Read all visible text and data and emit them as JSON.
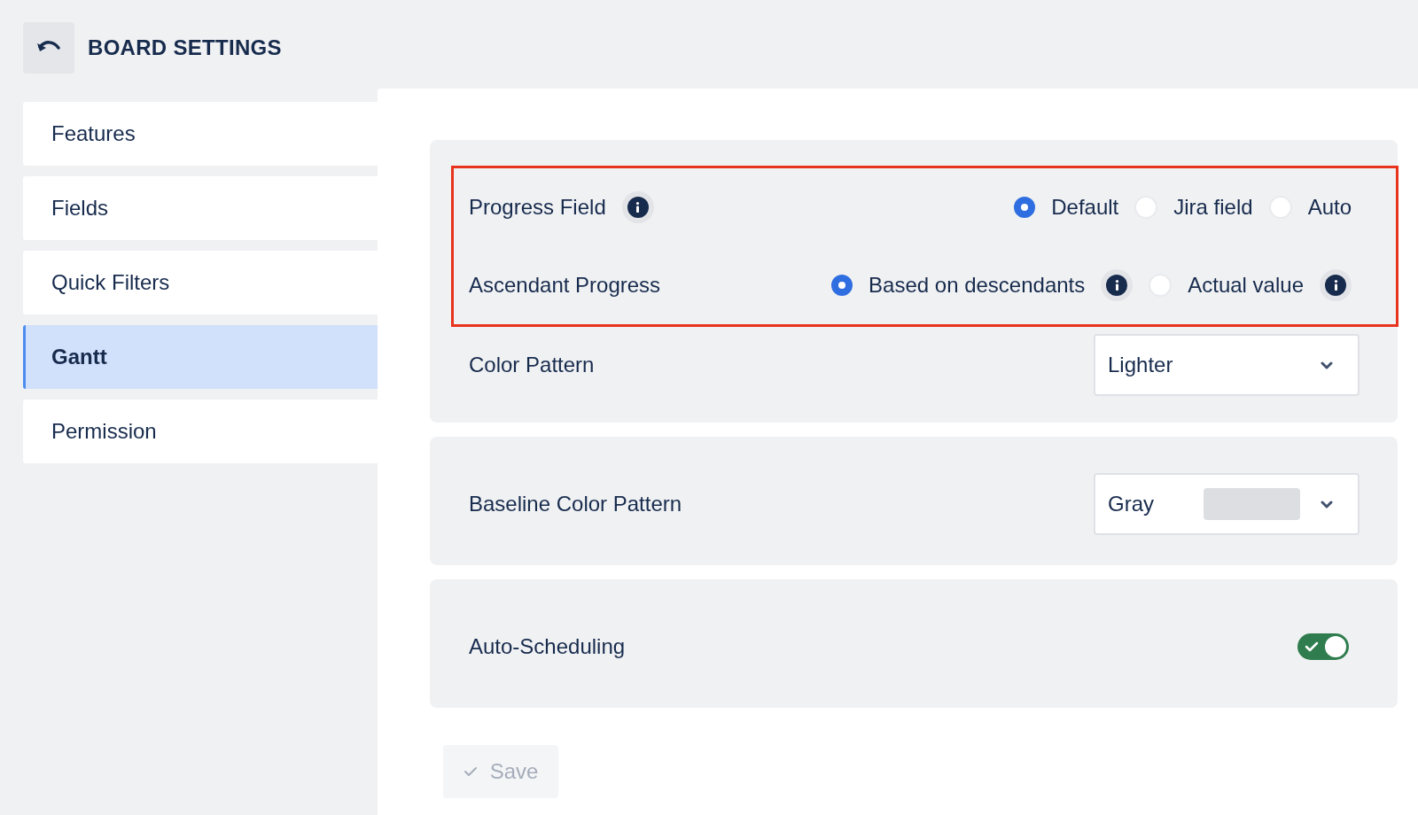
{
  "header": {
    "title": "BOARD SETTINGS"
  },
  "sidebar": {
    "items": [
      {
        "label": "Features",
        "selected": false
      },
      {
        "label": "Fields",
        "selected": false
      },
      {
        "label": "Quick Filters",
        "selected": false
      },
      {
        "label": "Gantt",
        "selected": true
      },
      {
        "label": "Permission",
        "selected": false
      }
    ]
  },
  "cards": [
    {
      "groups": [
        {
          "highlighted": true,
          "rows": [
            {
              "kind": "radio",
              "label": "Progress Field",
              "info": true,
              "options": [
                {
                  "label": "Default",
                  "selected": true,
                  "info": false
                },
                {
                  "label": "Jira field",
                  "selected": false,
                  "info": false
                },
                {
                  "label": "Auto",
                  "selected": false,
                  "info": false
                }
              ]
            },
            {
              "kind": "radio",
              "label": "Ascendant Progress",
              "info": false,
              "options": [
                {
                  "label": "Based on descendants",
                  "selected": true,
                  "info": true
                },
                {
                  "label": "Actual value",
                  "selected": false,
                  "info": true
                }
              ]
            }
          ]
        },
        {
          "highlighted": false,
          "rows": [
            {
              "kind": "select",
              "label": "Color Pattern",
              "value": "Lighter",
              "swatch": false
            }
          ]
        }
      ]
    },
    {
      "groups": [
        {
          "highlighted": false,
          "rows": [
            {
              "kind": "select",
              "label": "Baseline Color Pattern",
              "value": "Gray",
              "swatch": true
            }
          ]
        }
      ]
    },
    {
      "groups": [
        {
          "highlighted": false,
          "rows": [
            {
              "kind": "toggle",
              "label": "Auto-Scheduling",
              "on": true
            }
          ]
        }
      ]
    }
  ],
  "save_button": {
    "label": "Save",
    "disabled": true
  }
}
